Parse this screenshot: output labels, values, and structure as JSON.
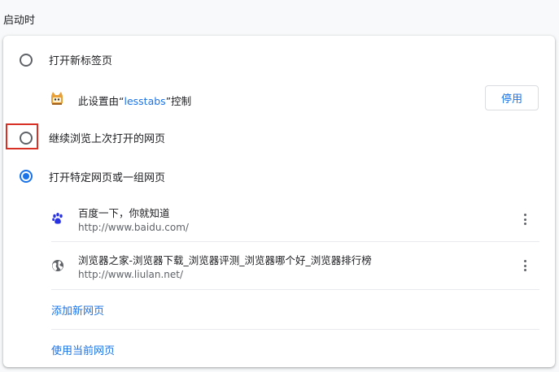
{
  "section": {
    "title": "启动时"
  },
  "options": {
    "new_tab": {
      "label": "打开新标签页",
      "selected": false
    },
    "managed": {
      "prefix": "此设置由“",
      "extension": "lesstabs",
      "suffix": "”控制",
      "button": "停用"
    },
    "continue": {
      "label": "继续浏览上次打开的网页",
      "selected": false
    },
    "specific": {
      "label": "打开特定网页或一组网页",
      "selected": true
    }
  },
  "pages": [
    {
      "title": "百度一下，你就知道",
      "url": "http://www.baidu.com/",
      "icon": "baidu-paw-icon"
    },
    {
      "title": "浏览器之家-浏览器下载_浏览器评测_浏览器哪个好_浏览器排行榜",
      "url": "http://www.liulan.net/",
      "icon": "globe-icon"
    }
  ],
  "actions": {
    "add_page": "添加新网页",
    "use_current": "使用当前网页"
  },
  "colors": {
    "accent": "#1a73e8",
    "highlight": "#d93025"
  }
}
